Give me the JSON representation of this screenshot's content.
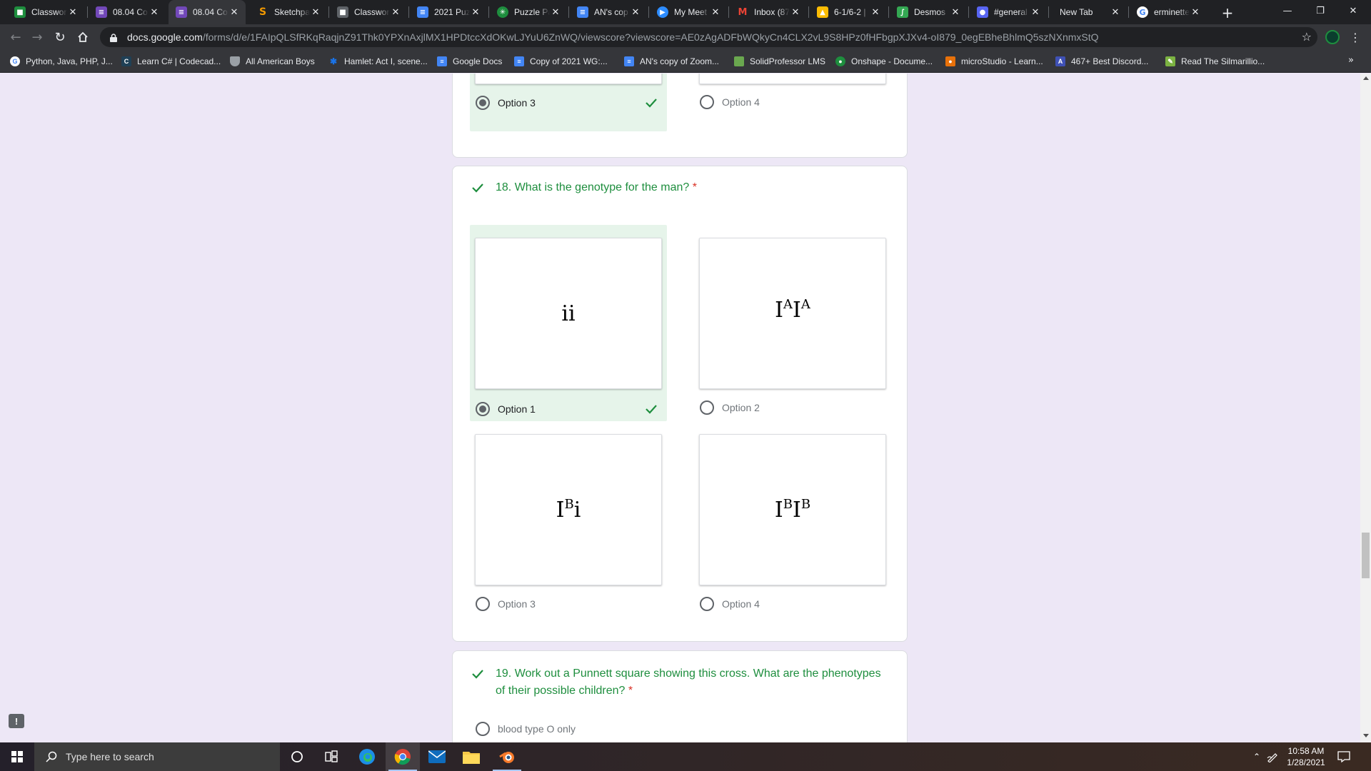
{
  "browser": {
    "tabs": [
      {
        "title": "Classwork",
        "icon": "classroom-icon",
        "color": "#1e8e3e"
      },
      {
        "title": "08.04 Co",
        "icon": "forms-icon",
        "color": "#7248b9"
      },
      {
        "title": "08.04 Co",
        "icon": "forms-icon",
        "color": "#7248b9",
        "active": true
      },
      {
        "title": "Sketchpad",
        "icon": "sketchpad-icon",
        "color": "#f29900"
      },
      {
        "title": "Classwork",
        "icon": "classroom-icon",
        "color": "#5f6368"
      },
      {
        "title": "2021 Puz",
        "icon": "docs-icon",
        "color": "#4285f4"
      },
      {
        "title": "Puzzle Pa",
        "icon": "puzzle-icon",
        "color": "#1e8e3e"
      },
      {
        "title": "AN's cop",
        "icon": "docs-icon",
        "color": "#4285f4"
      },
      {
        "title": "My Meet",
        "icon": "zoom-icon",
        "color": "#2d8cff"
      },
      {
        "title": "Inbox (87",
        "icon": "gmail-icon",
        "color": "#ea4335"
      },
      {
        "title": "6-1/6-2 |",
        "icon": "drive-icon",
        "color": "#fbbc04"
      },
      {
        "title": "Desmos",
        "icon": "desmos-icon",
        "color": "#34a853"
      },
      {
        "title": "#general",
        "icon": "discord-icon",
        "color": "#5865f2"
      },
      {
        "title": "New Tab",
        "icon": "",
        "color": ""
      },
      {
        "title": "erminette",
        "icon": "google-icon",
        "color": "#ffffff"
      }
    ],
    "url_host": "docs.google.com",
    "url_path": "/forms/d/e/1FAIpQLSfRKqRaqjnZ91Thk0YPXnAxjlMX1HPDtccXdOKwLJYuU6ZnWQ/viewscore?viewscore=AE0zAgADFbWQkyCn4CLX2vL9S8HPz0fHFbgpXJXv4-oI879_0egEBheBhlmQ5szNXnmxStQ",
    "bookmarks": [
      {
        "label": "Python, Java, PHP, J...",
        "icon": "google-icon",
        "color": "#ffffff"
      },
      {
        "label": "Learn C# | Codecad...",
        "icon": "codecademy-icon",
        "color": "#1f4056"
      },
      {
        "label": "All American Boys",
        "icon": "shield-icon",
        "color": "#9aa0a6"
      },
      {
        "label": "Hamlet: Act I, scene...",
        "icon": "star-icon",
        "color": "#1a73e8"
      },
      {
        "label": "Google Docs",
        "icon": "docs-icon",
        "color": "#4285f4"
      },
      {
        "label": "Copy of 2021 WG:...",
        "icon": "docs-icon",
        "color": "#4285f4"
      },
      {
        "label": "AN's copy of Zoom...",
        "icon": "docs-icon",
        "color": "#4285f4"
      },
      {
        "label": "SolidProfessor LMS",
        "icon": "solidprofessor-icon",
        "color": "#6aa84f"
      },
      {
        "label": "Onshape - Docume...",
        "icon": "onshape-icon",
        "color": "#1e8e3e"
      },
      {
        "label": "microStudio - Learn...",
        "icon": "microstudio-icon",
        "color": "#e8710a"
      },
      {
        "label": "467+ Best Discord...",
        "icon": "discord-list-icon",
        "color": "#3f51b5"
      },
      {
        "label": "Read The Silmarillio...",
        "icon": "book-icon",
        "color": "#7cb342"
      }
    ]
  },
  "form": {
    "prev_question": {
      "options": [
        {
          "label": "Option 3",
          "selected": true,
          "correct": true
        },
        {
          "label": "Option 4",
          "selected": false
        }
      ]
    },
    "q18": {
      "title": "18. What is the genotype for the man?",
      "required_mark": "*",
      "options": [
        {
          "label": "Option 1",
          "base1": "ii",
          "sup1": "",
          "base2": "",
          "sup2": "",
          "selected": true,
          "correct": true
        },
        {
          "label": "Option 2",
          "base1": "I",
          "sup1": "A",
          "base2": "I",
          "sup2": "A",
          "selected": false
        },
        {
          "label": "Option 3",
          "base1": "I",
          "sup1": "B",
          "base2": "i",
          "sup2": "",
          "selected": false
        },
        {
          "label": "Option 4",
          "base1": "I",
          "sup1": "B",
          "base2": "I",
          "sup2": "B",
          "selected": false
        }
      ]
    },
    "q19": {
      "title": "19. Work out a Punnett square showing this cross. What are the phenotypes of their possible children?",
      "required_mark": "*",
      "first_option": "blood type O only"
    },
    "accent_color": "#1e8e3e",
    "correct_bg": "#e6f4ea",
    "feedback_label": "!"
  },
  "taskbar": {
    "search_placeholder": "Type here to search",
    "time": "10:58 AM",
    "date": "1/28/2021",
    "apps": [
      "cortana-icon",
      "task-view-icon",
      "edge-icon",
      "chrome-icon",
      "mail-icon",
      "file-explorer-icon",
      "blender-icon"
    ]
  }
}
